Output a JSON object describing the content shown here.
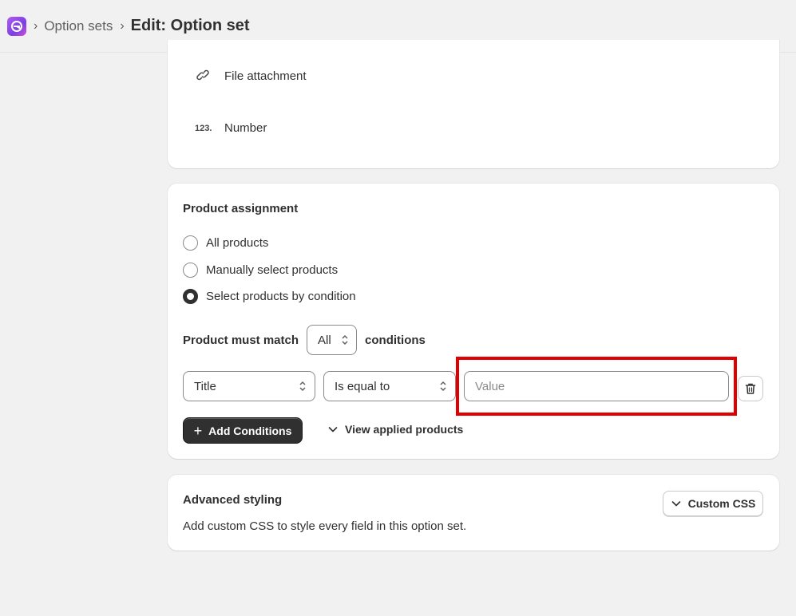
{
  "breadcrumb": {
    "parent": "Option sets",
    "separator": "›",
    "title": "Edit: Option set"
  },
  "field_types": [
    {
      "icon": "link-icon",
      "label": "File attachment"
    },
    {
      "icon_text": "123.",
      "icon": "number-icon",
      "label": "Number"
    }
  ],
  "assignment": {
    "title": "Product assignment",
    "options": [
      "All products",
      "Manually select products",
      "Select products by condition"
    ],
    "selected_index": 2,
    "match_prefix": "Product must match",
    "match_value": "All",
    "match_suffix": "conditions",
    "condition": {
      "field": "Title",
      "operator": "Is equal to",
      "value_placeholder": "Value"
    },
    "add_button": "Add Conditions",
    "add_icon": "+",
    "view_link": "View applied products"
  },
  "advanced": {
    "title": "Advanced styling",
    "description": "Add custom CSS to style every field in this option set.",
    "button": "Custom CSS"
  },
  "colors": {
    "highlight": "#e00000",
    "primary_button": "#303030",
    "logo": "#9b4ff0"
  }
}
